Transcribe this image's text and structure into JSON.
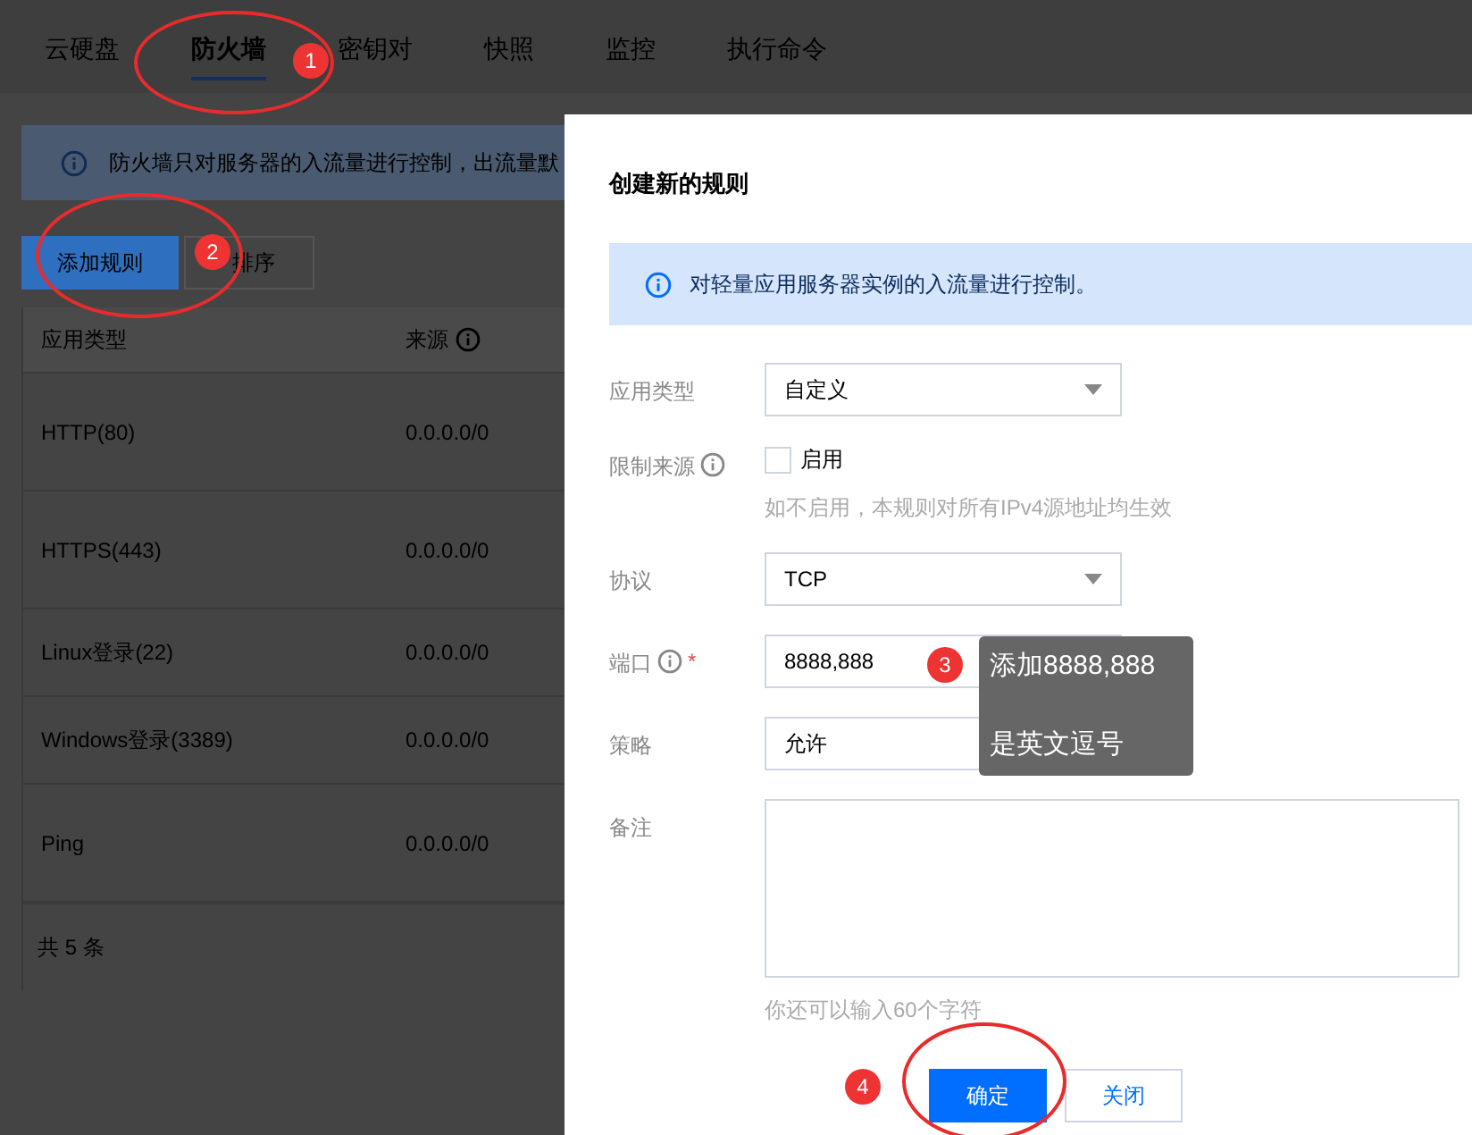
{
  "tabs": [
    {
      "label": "云硬盘",
      "selected": false
    },
    {
      "label": "防火墙",
      "selected": true
    },
    {
      "label": "密钥对",
      "selected": false
    },
    {
      "label": "快照",
      "selected": false
    },
    {
      "label": "监控",
      "selected": false
    },
    {
      "label": "执行命令",
      "selected": false
    }
  ],
  "notice": "防火墙只对服务器的入流量进行控制，出流量默",
  "actions": [
    {
      "label": "添加规则",
      "kind": "primary"
    },
    {
      "label": "排序",
      "kind": "default"
    }
  ],
  "table": {
    "columns": [
      "应用类型",
      "来源"
    ],
    "rows": [
      {
        "cells": [
          "HTTP(80)",
          "0.0.0.0/0"
        ]
      },
      {
        "cells": [
          "HTTPS(443)",
          "0.0.0.0/0"
        ]
      },
      {
        "cells": [
          "Linux登录(22)",
          "0.0.0.0/0"
        ]
      },
      {
        "cells": [
          "Windows登录(3389)",
          "0.0.0.0/0"
        ]
      },
      {
        "cells": [
          "Ping",
          "0.0.0.0/0"
        ]
      }
    ],
    "footer": "共 5 条"
  },
  "dialog": {
    "title": "创建新的规则",
    "info": "对轻量应用服务器实例的入流量进行控制。",
    "fields": [
      {
        "kind": "select",
        "label": "应用类型",
        "value": "自定义",
        "info": false
      },
      {
        "kind": "checkbox",
        "label": "限制来源",
        "info": true,
        "option": "启用",
        "checked": false,
        "hint": "如不启用，本规则对所有IPv4源地址均生效"
      },
      {
        "kind": "select",
        "label": "协议",
        "value": "TCP",
        "info": false
      },
      {
        "kind": "input",
        "label": "端口",
        "value": "8888,888",
        "info": true,
        "required_mark": "*"
      },
      {
        "kind": "select",
        "label": "策略",
        "value": "允许",
        "info": false
      },
      {
        "kind": "textarea",
        "label": "备注",
        "info": false,
        "hint": "你还可以输入60个字符"
      }
    ],
    "buttons": [
      {
        "label": "确定",
        "kind": "primary"
      },
      {
        "label": "关闭",
        "kind": "default"
      }
    ]
  },
  "annotations": {
    "badges": [
      "1",
      "2",
      "3",
      "4"
    ],
    "tooltip": [
      "添加8888,888",
      "是英文逗号"
    ]
  }
}
